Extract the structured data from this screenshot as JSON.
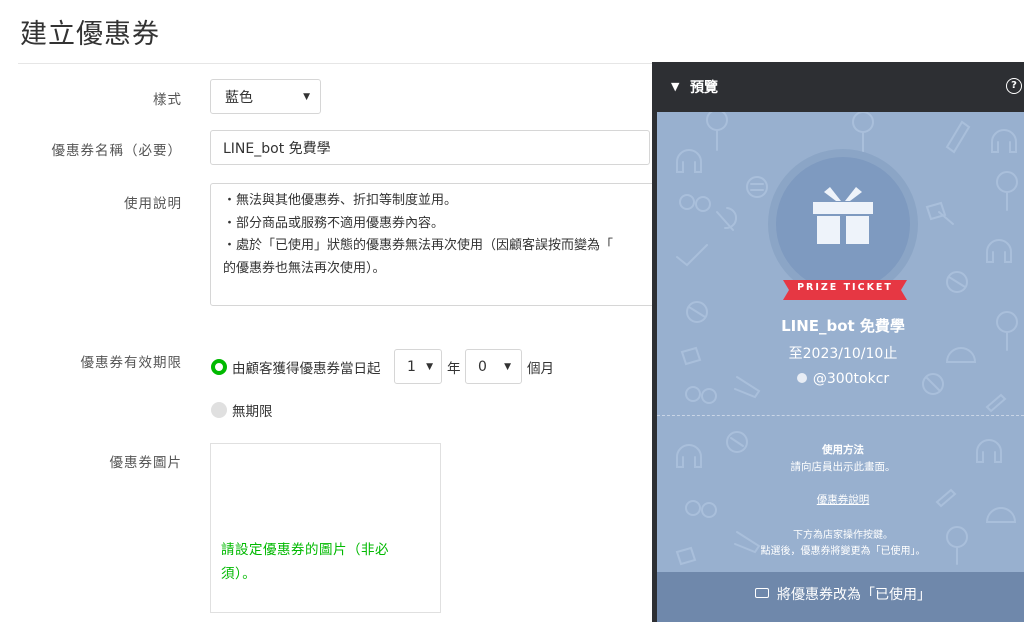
{
  "page": {
    "title": "建立優惠券"
  },
  "form": {
    "style": {
      "label": "樣式",
      "value": "藍色"
    },
    "name": {
      "label": "優惠券名稱（必要）",
      "value": "LINE_bot 免費學"
    },
    "description": {
      "label": "使用說明",
      "lines": [
        "・無法與其他優惠券、折扣等制度並用。",
        "・部分商品或服務不適用優惠券內容。",
        "・處於「已使用」狀態的優惠券無法再次使用（因顧客誤按而變為「",
        "的優惠券也無法再次使用）。"
      ]
    },
    "validity": {
      "label": "優惠券有效期限",
      "option_from_date": "由顧客獲得優惠券當日起",
      "years_value": "1",
      "years_unit": "年",
      "months_value": "0",
      "months_unit": "個月",
      "option_unlimited": "無期限"
    },
    "image": {
      "label": "優惠券圖片",
      "hint_line1": "請設定優惠券的圖片（非必",
      "hint_line2": "須）。"
    }
  },
  "preview": {
    "title": "預覽",
    "help_icon": "question-circle-icon",
    "ribbon": "PRIZE TICKET",
    "coupon_name": "LINE_bot 免費學",
    "valid_until": "至2023/10/10止",
    "account": "@300tokcr",
    "how_to_title": "使用方法",
    "how_to_text": "請向店員出示此畫面。",
    "details_link": "優惠券說明",
    "note_line1": "下方為店家操作按鍵。",
    "note_line2": "點選後，優惠券將變更為「已使用」。",
    "use_button": "將優惠券改為「已使用」"
  },
  "colors": {
    "accent": "#00b900",
    "preview_header": "#2d2f33",
    "coupon_bg": "#98b0cf",
    "ribbon": "#e63743"
  }
}
